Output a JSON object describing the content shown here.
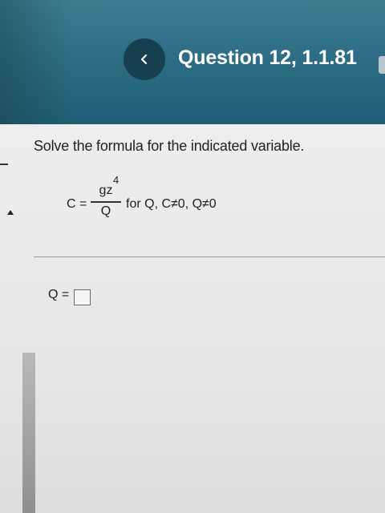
{
  "header": {
    "back_icon": "chevron-left-icon",
    "title": "Question 12, 1.1.81"
  },
  "question": {
    "instruction": "Solve the formula for the indicated variable.",
    "equation": {
      "lhs": "C =",
      "numerator": "gz",
      "exponent": "4",
      "denominator": "Q",
      "conditions": "for Q,  C≠0, Q≠0"
    }
  },
  "answer": {
    "label": "Q =",
    "value": ""
  },
  "colors": {
    "header_bg": "#2f6f86",
    "back_button_bg": "#163f4f",
    "content_bg": "#eeeeec"
  }
}
